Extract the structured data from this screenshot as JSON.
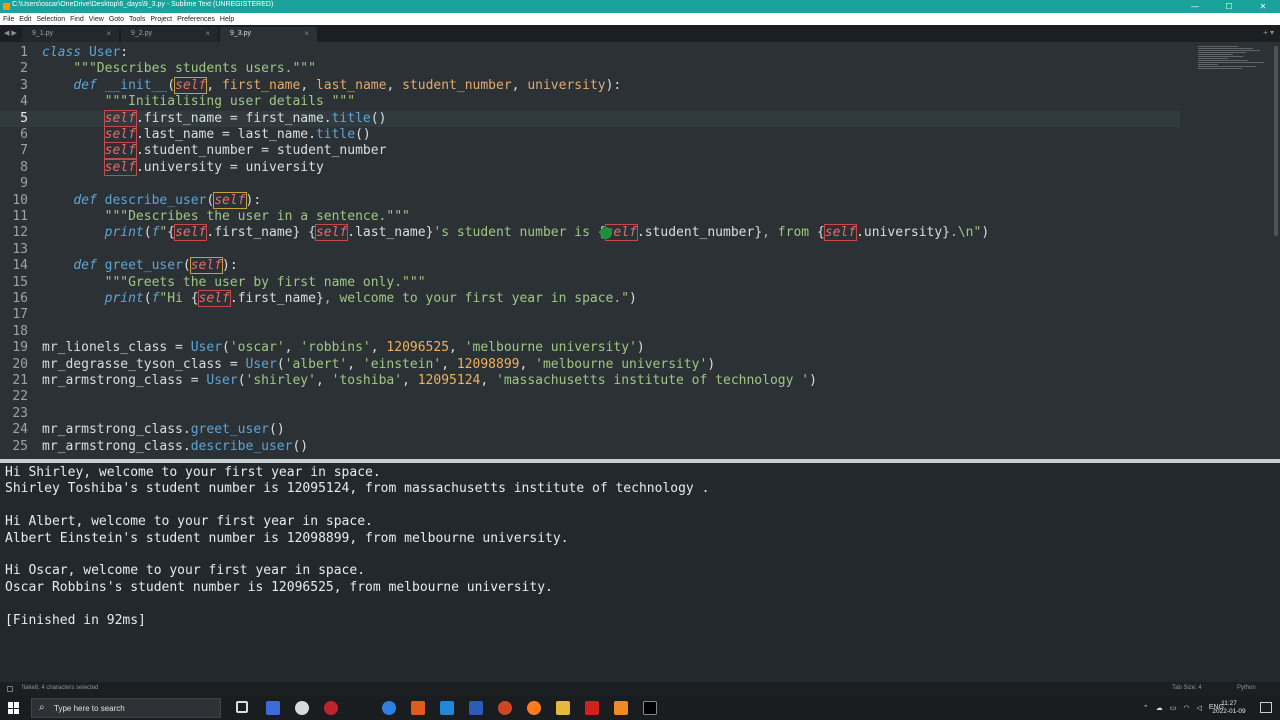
{
  "window": {
    "title": "C:\\Users\\oscar\\OneDrive\\Desktop\\6_days\\9_3.py - Sublime Text (UNREGISTERED)",
    "controls": [
      "—",
      "☐",
      "✕"
    ]
  },
  "menu": [
    "File",
    "Edit",
    "Selection",
    "Find",
    "View",
    "Goto",
    "Tools",
    "Project",
    "Preferences",
    "Help"
  ],
  "tabs": [
    {
      "label": "9_1.py",
      "close": "×"
    },
    {
      "label": "9_2.py",
      "close": "×"
    },
    {
      "label": "9_3.py",
      "close": "×"
    }
  ],
  "tab_nav": "◀ ▶",
  "tab_actions": "+ ▾",
  "editor": {
    "current_line": 5,
    "line_numbers": [
      "1",
      "2",
      "3",
      "4",
      "5",
      "6",
      "7",
      "8",
      "9",
      "10",
      "11",
      "12",
      "13",
      "14",
      "15",
      "16",
      "17",
      "18",
      "19",
      "20",
      "21",
      "22",
      "23",
      "24",
      "25"
    ]
  },
  "output": {
    "lines": [
      "Hi Shirley, welcome to your first year in space.",
      "Shirley Toshiba's student number is 12095124, from massachusetts institute of technology .",
      "",
      "Hi Albert, welcome to your first year in space.",
      "Albert Einstein's student number is 12098899, from melbourne university.",
      "",
      "Hi Oscar, welcome to your first year in space.",
      "Oscar Robbins's student number is 12096525, from melbourne university.",
      "",
      "[Finished in 92ms]"
    ]
  },
  "status": {
    "text": "flake8, 4 characters selected",
    "tab_size": "Tab Size: 4",
    "syntax": "Python"
  },
  "taskbar": {
    "search_placeholder": "Type here to search",
    "language": "ENG",
    "time": "11:27",
    "date": "2022-01-09"
  },
  "colors": {
    "titlebar": "#1aa39a",
    "editor_bg": "#2b3135",
    "output_bg": "#22282c",
    "keyword": "#5fa4d4",
    "string": "#9fc783",
    "number": "#f2b05c",
    "self": "#e66b6b"
  }
}
